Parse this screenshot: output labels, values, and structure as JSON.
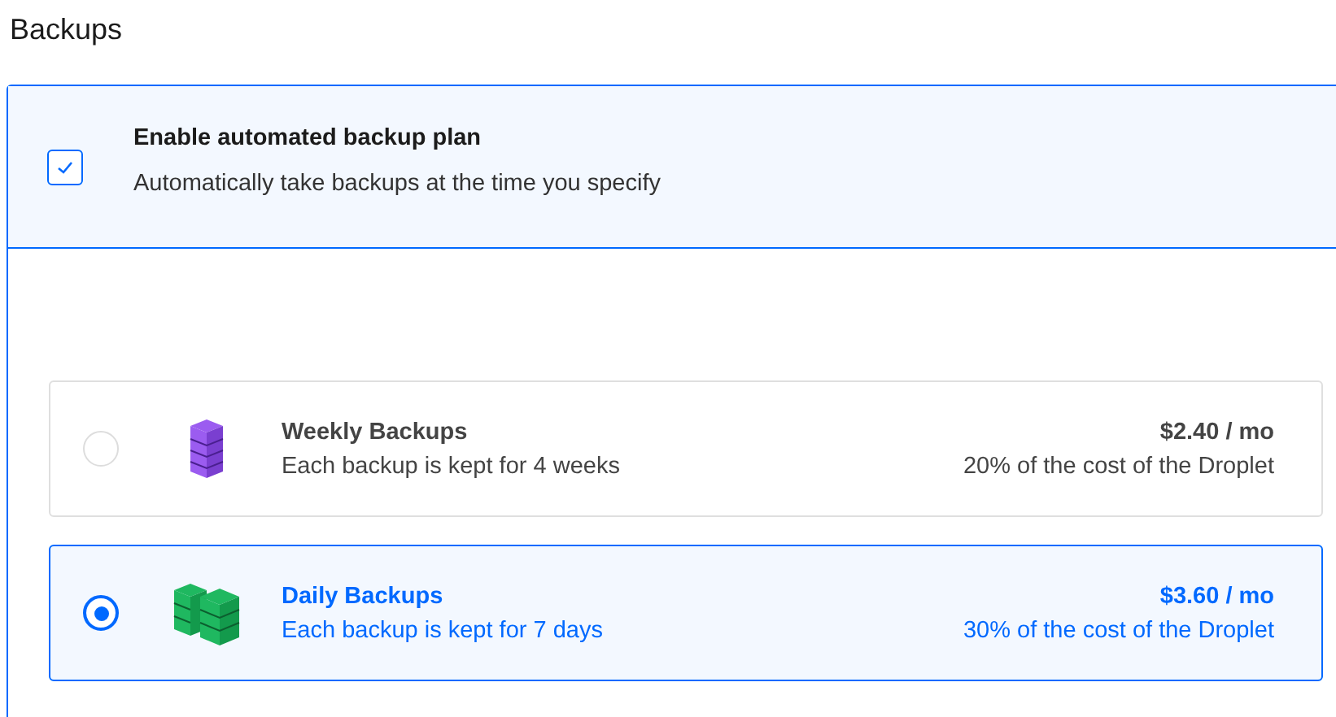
{
  "title": "Backups",
  "enable": {
    "checked": true,
    "label": "Enable automated backup plan",
    "description": "Automatically take backups at the time you specify"
  },
  "plans": [
    {
      "kind": "single",
      "color": "#9b5cf0",
      "name": "Weekly Backups",
      "detail": "Each backup is kept for 4 weeks",
      "price": "$2.40 / mo",
      "cost": "20% of the cost of the Droplet",
      "selected": false
    },
    {
      "kind": "double",
      "color": "#1fb860",
      "name": "Daily Backups",
      "detail": "Each backup is kept for 7 days",
      "price": "$3.60 / mo",
      "cost": "30% of the cost of the Droplet",
      "selected": true
    }
  ]
}
